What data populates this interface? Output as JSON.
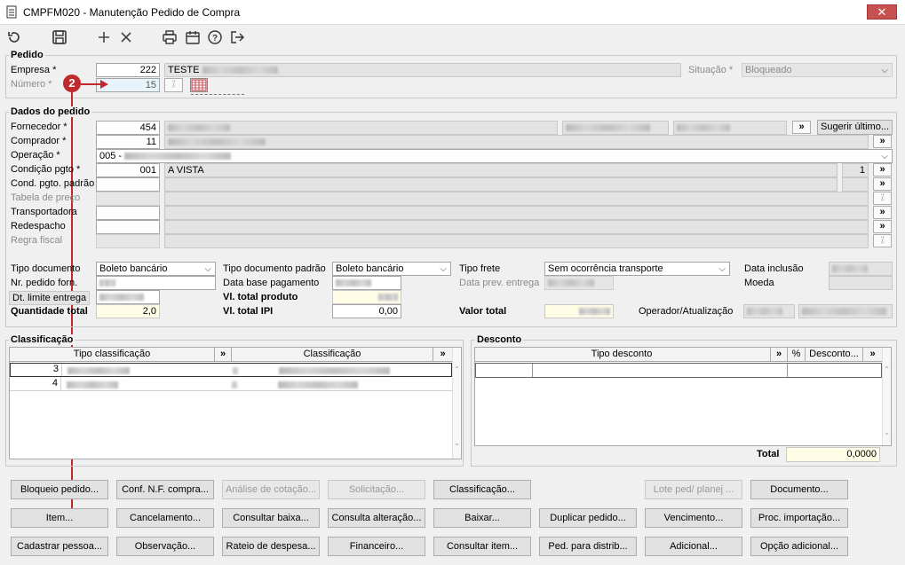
{
  "window": {
    "title": "CMPFM020 - Manutenção Pedido de Compra",
    "close_glyph": "✕"
  },
  "toolbar": {
    "icons": [
      "refresh-icon",
      "save-icon",
      "add-icon",
      "delete-icon",
      "print-icon",
      "calendar-icon",
      "help-icon",
      "exit-icon"
    ]
  },
  "pedido": {
    "section_label": "Pedido",
    "empresa_label": "Empresa *",
    "empresa_code": "222",
    "empresa_name": "TESTE",
    "numero_label": "Número *",
    "numero_value": "15",
    "situacao_label": "Situação *",
    "situacao_value": "Bloqueado"
  },
  "annotation": {
    "step": "2",
    "color": "#c0292e"
  },
  "dados": {
    "section_label": "Dados do pedido",
    "fornecedor_label": "Fornecedor *",
    "fornecedor_code": "454",
    "comprador_label": "Comprador *",
    "comprador_code": "11",
    "operacao_label": "Operação *",
    "operacao_value": "005 -",
    "condicao_label": "Condição pgto *",
    "condicao_code": "001",
    "condicao_name": "A VISTA",
    "condicao_parcelas": "1",
    "cond_padrao_label": "Cond. pgto. padrão",
    "tabela_label": "Tabela de preço",
    "transportadora_label": "Transportadora",
    "redespacho_label": "Redespacho",
    "regra_label": "Regra fiscal",
    "sugerir_label": "Sugerir último...",
    "more_glyph": "»",
    "tipo_doc_label": "Tipo documento",
    "tipo_doc_value": "Boleto bancário",
    "tipo_doc_padrao_label": "Tipo documento padrão",
    "tipo_doc_padrao_value": "Boleto bancário",
    "tipo_frete_label": "Tipo frete",
    "tipo_frete_value": "Sem ocorrência transporte",
    "data_inclusao_label": "Data inclusão",
    "nr_pedido_label": "Nr. pedido forn.",
    "data_base_label": "Data base pagamento",
    "data_prev_label": "Data prev. entrega",
    "moeda_label": "Moeda",
    "dt_limite_label": "Dt. limite entrega",
    "vl_total_produto_label": "Vl. total produto",
    "quantidade_label": "Quantidade total",
    "quantidade_value": "2,0",
    "vl_total_ipi_label": "Vl. total IPI",
    "vl_total_ipi_value": "0,00",
    "valor_total_label": "Valor total",
    "operador_label": "Operador/Atualização"
  },
  "classificacao": {
    "section_label": "Classificação",
    "col_tipo": "Tipo classificação",
    "col_class": "Classificação",
    "rows": [
      {
        "tipo": "3"
      },
      {
        "tipo": "4"
      }
    ]
  },
  "desconto": {
    "section_label": "Desconto",
    "col_tipo": "Tipo desconto",
    "col_pct": "%",
    "col_desc": "Desconto...",
    "total_label": "Total",
    "total_value": "0,0000"
  },
  "buttons": {
    "row1": [
      "Bloqueio pedido...",
      "Conf. N.F. compra...",
      "Análise de cotação...",
      "Solicitação...",
      "Classificação...",
      "Lote ped/ planej ...",
      "Documento..."
    ],
    "row2": [
      "Item...",
      "Cancelamento...",
      "Consultar baixa...",
      "Consulta alteração...",
      "Baixar...",
      "Duplicar pedido...",
      "Vencimento...",
      "Proc. importação..."
    ],
    "row3": [
      "Cadastrar pessoa...",
      "Observação...",
      "Rateio de despesa...",
      "Financeiro...",
      "Consultar item...",
      "Ped. para distrib...",
      "Adicional...",
      "Opção adicional..."
    ]
  }
}
